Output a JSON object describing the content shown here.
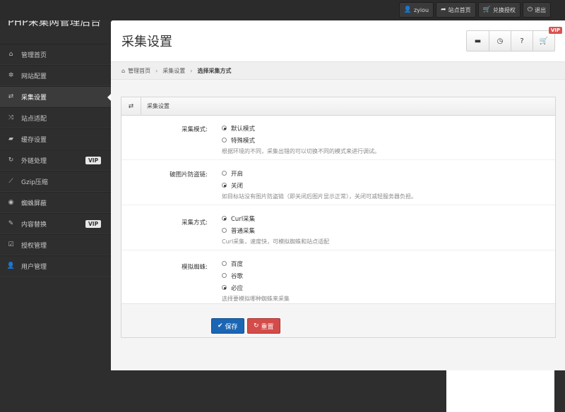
{
  "app": {
    "brand": "PHP采集网管理后台"
  },
  "topbar": {
    "buttons": [
      {
        "icon": "user-icon",
        "label": "zyiou"
      },
      {
        "icon": "share-icon",
        "label": "站点首页"
      },
      {
        "icon": "cart-icon",
        "label": "兑换授权"
      },
      {
        "icon": "power-icon",
        "label": "退出"
      }
    ]
  },
  "sidebar": {
    "items": [
      {
        "icon": "home-icon",
        "label": "管理首页",
        "active": false,
        "vip": ""
      },
      {
        "icon": "cog-icon",
        "label": "网站配置",
        "active": false,
        "vip": ""
      },
      {
        "icon": "retweet-icon",
        "label": "采集设置",
        "active": true,
        "vip": ""
      },
      {
        "icon": "random-icon",
        "label": "站点适配",
        "active": false,
        "vip": ""
      },
      {
        "icon": "folder-open-icon",
        "label": "缓存设置",
        "active": false,
        "vip": ""
      },
      {
        "icon": "refresh-icon",
        "label": "外链处理",
        "active": false,
        "vip": "VIP"
      },
      {
        "icon": "wrench-icon",
        "label": "Gzip压缩",
        "active": false,
        "vip": ""
      },
      {
        "icon": "eye-icon",
        "label": "蜘蛛屏蔽",
        "active": false,
        "vip": ""
      },
      {
        "icon": "pencil-icon",
        "label": "内容替换",
        "active": false,
        "vip": "VIP"
      },
      {
        "icon": "check-icon",
        "label": "授权管理",
        "active": false,
        "vip": ""
      },
      {
        "icon": "user-icon",
        "label": "用户管理",
        "active": false,
        "vip": ""
      }
    ]
  },
  "header": {
    "title": "采集设置",
    "tools": [
      {
        "icon": "comment-icon"
      },
      {
        "icon": "clock-icon"
      },
      {
        "icon": "question-icon"
      },
      {
        "icon": "cart-icon",
        "badge": "VIP"
      }
    ]
  },
  "breadcrumb": {
    "items": [
      "管理首页",
      "采集设置"
    ],
    "current": "选择采集方式"
  },
  "panel": {
    "title": "采集设置",
    "fields": [
      {
        "label": "采集模式:",
        "options": [
          {
            "label": "默认模式",
            "checked": true
          },
          {
            "label": "特殊模式",
            "checked": false
          }
        ],
        "hint": "根据环境的不同，采集出错的可以切换不同的模式来进行调试。"
      },
      {
        "label": "破图片防盗链:",
        "options": [
          {
            "label": "开启",
            "checked": false
          },
          {
            "label": "关闭",
            "checked": true
          }
        ],
        "hint": "如目标站没有图片防盗链（即关闭后图片显示正常），关闭可减轻服务器负担。"
      },
      {
        "label": "采集方式:",
        "options": [
          {
            "label": "Curl采集",
            "checked": true
          },
          {
            "label": "普通采集",
            "checked": false
          }
        ],
        "hint": "Curl采集，速度快，可模拟蜘蛛和站点适配"
      },
      {
        "label": "模拟蜘蛛:",
        "options": [
          {
            "label": "百度",
            "checked": false
          },
          {
            "label": "谷歌",
            "checked": false
          },
          {
            "label": "必应",
            "checked": true
          }
        ],
        "hint": "选择要模拟哪种蜘蛛来采集"
      }
    ]
  },
  "actions": {
    "save_label": "保存",
    "reset_label": "重置"
  }
}
